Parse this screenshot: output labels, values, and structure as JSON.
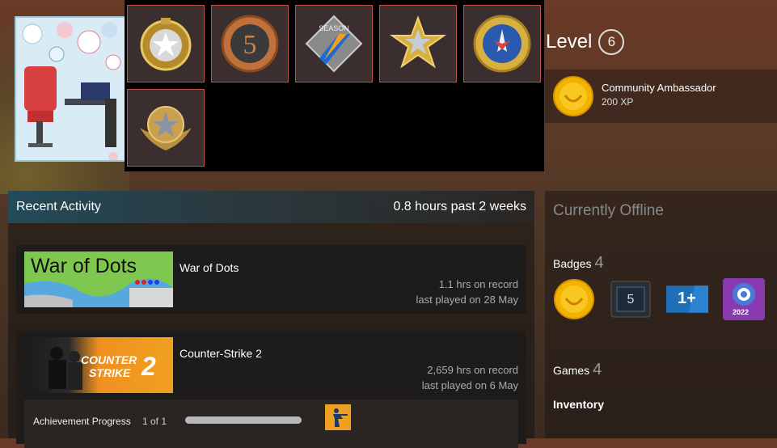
{
  "showcase": {
    "medals": [
      {
        "name": "service-medal-gold-icon"
      },
      {
        "name": "5-year-veteran-coin-icon"
      },
      {
        "name": "operation-season-coin-icon"
      },
      {
        "name": "service-medal-silver-star-icon"
      },
      {
        "name": "counter-strike-coin-2022-icon"
      },
      {
        "name": "service-medal-winged-star-icon"
      }
    ]
  },
  "level": {
    "label": "Level",
    "value": "6"
  },
  "favorite_badge": {
    "name": "Community Ambassador",
    "xp": "200 XP"
  },
  "recent_activity": {
    "title": "Recent Activity",
    "hours": "0.8 hours past 2 weeks",
    "games": [
      {
        "name": "War of Dots",
        "thumb_text": "War of Dots",
        "hours": "1.1 hrs on record",
        "last_played": "last played on 28 May"
      },
      {
        "name": "Counter-Strike 2",
        "thumb_text_1": "COUNTER",
        "thumb_text_2": "STRIKE",
        "thumb_text_3": "2",
        "hours": "2,659 hrs on record",
        "last_played": "last played on 6 May",
        "achievement": {
          "label": "Achievement Progress",
          "count": "1 of 1",
          "progress": 1.0
        }
      }
    ]
  },
  "sidebar": {
    "status": "Currently Offline",
    "badges": {
      "label": "Badges",
      "count": "4",
      "items": [
        {
          "name": "community-ambassador-badge-icon"
        },
        {
          "name": "years-of-service-5-badge-icon",
          "text": "5"
        },
        {
          "name": "one-plus-badge-icon",
          "text": "1+"
        },
        {
          "name": "steam-replay-2022-badge-icon",
          "text": "2022"
        }
      ]
    },
    "games": {
      "label": "Games",
      "count": "4"
    },
    "inventory": {
      "label": "Inventory"
    }
  },
  "colors": {
    "accent_border": "#c0504a",
    "header_teal": "#234a58",
    "gold": "#f0b400"
  }
}
